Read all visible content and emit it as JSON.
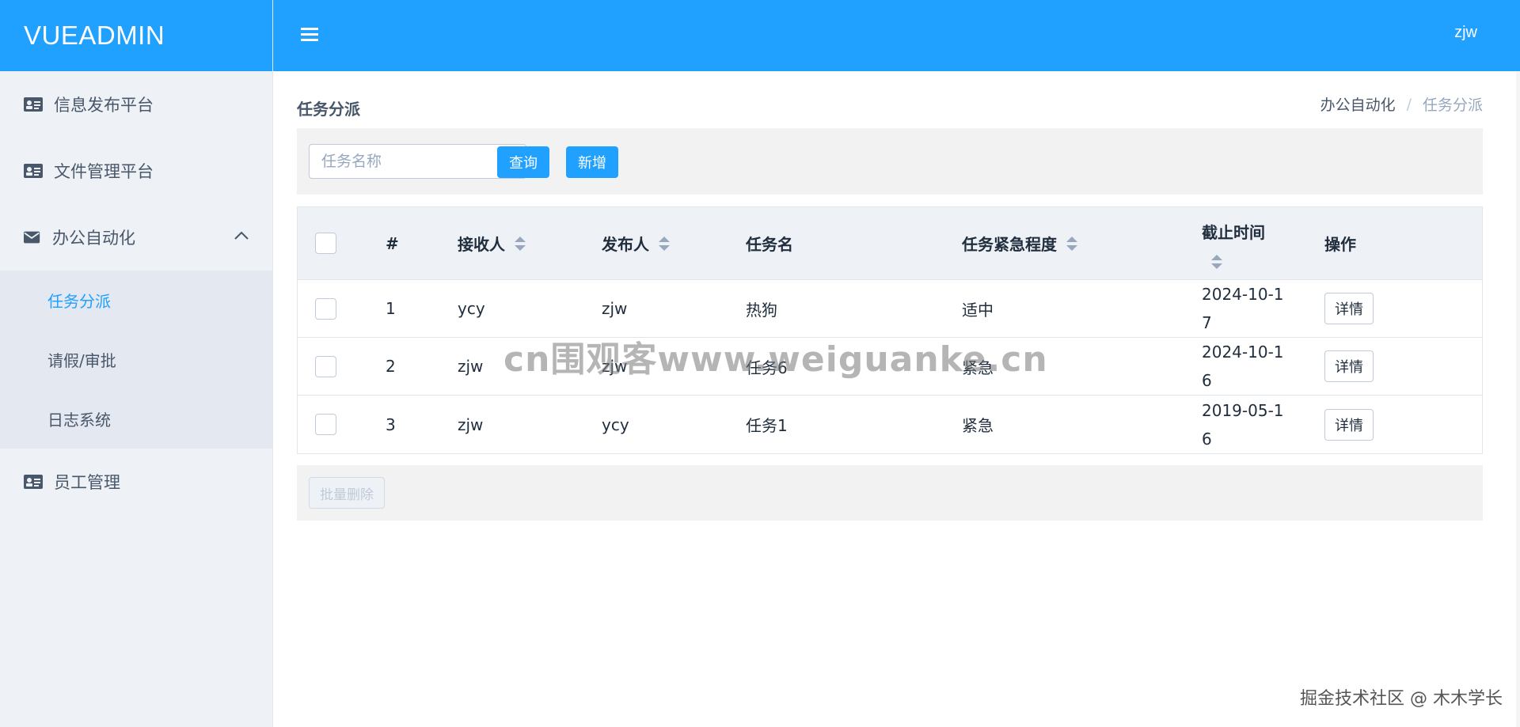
{
  "app": {
    "brand": "VUEADMIN",
    "user": "zjw"
  },
  "sidebar": {
    "items": [
      {
        "label": "信息发布平台",
        "icon": "id-card-icon"
      },
      {
        "label": "文件管理平台",
        "icon": "id-card-icon"
      },
      {
        "label": "办公自动化",
        "icon": "envelope-icon",
        "expanded": true,
        "children": [
          {
            "label": "任务分派",
            "active": true
          },
          {
            "label": "请假/审批"
          },
          {
            "label": "日志系统"
          }
        ]
      },
      {
        "label": "员工管理",
        "icon": "id-card-icon"
      }
    ]
  },
  "page": {
    "title": "任务分派",
    "breadcrumb": [
      "办公自动化",
      "任务分派"
    ]
  },
  "toolbar": {
    "search_placeholder": "任务名称",
    "search_value": "",
    "query_label": "查询",
    "add_label": "新增"
  },
  "table": {
    "columns": [
      "#",
      "接收人",
      "发布人",
      "任务名",
      "任务紧急程度",
      "截止时间",
      "操作"
    ],
    "rows": [
      {
        "id": "1",
        "receiver": "ycy",
        "publisher": "zjw",
        "name": "热狗",
        "urgency": "适中",
        "deadline": "2024-10-17",
        "action": "详情"
      },
      {
        "id": "2",
        "receiver": "zjw",
        "publisher": "zjw",
        "name": "任务6",
        "urgency": "紧急",
        "deadline": "2024-10-16",
        "action": "详情"
      },
      {
        "id": "3",
        "receiver": "zjw",
        "publisher": "ycy",
        "name": "任务1",
        "urgency": "紧急",
        "deadline": "2019-05-16",
        "action": "详情"
      }
    ]
  },
  "footer": {
    "batch_delete_label": "批量删除"
  },
  "overlay": {
    "watermark": "cn围观客www.weiguanke.cn",
    "credit": "掘金技术社区 @ 木木学长"
  },
  "colors": {
    "primary": "#20a0ff",
    "sidebar_bg": "#eef1f6",
    "active_text": "#20a0ff"
  }
}
